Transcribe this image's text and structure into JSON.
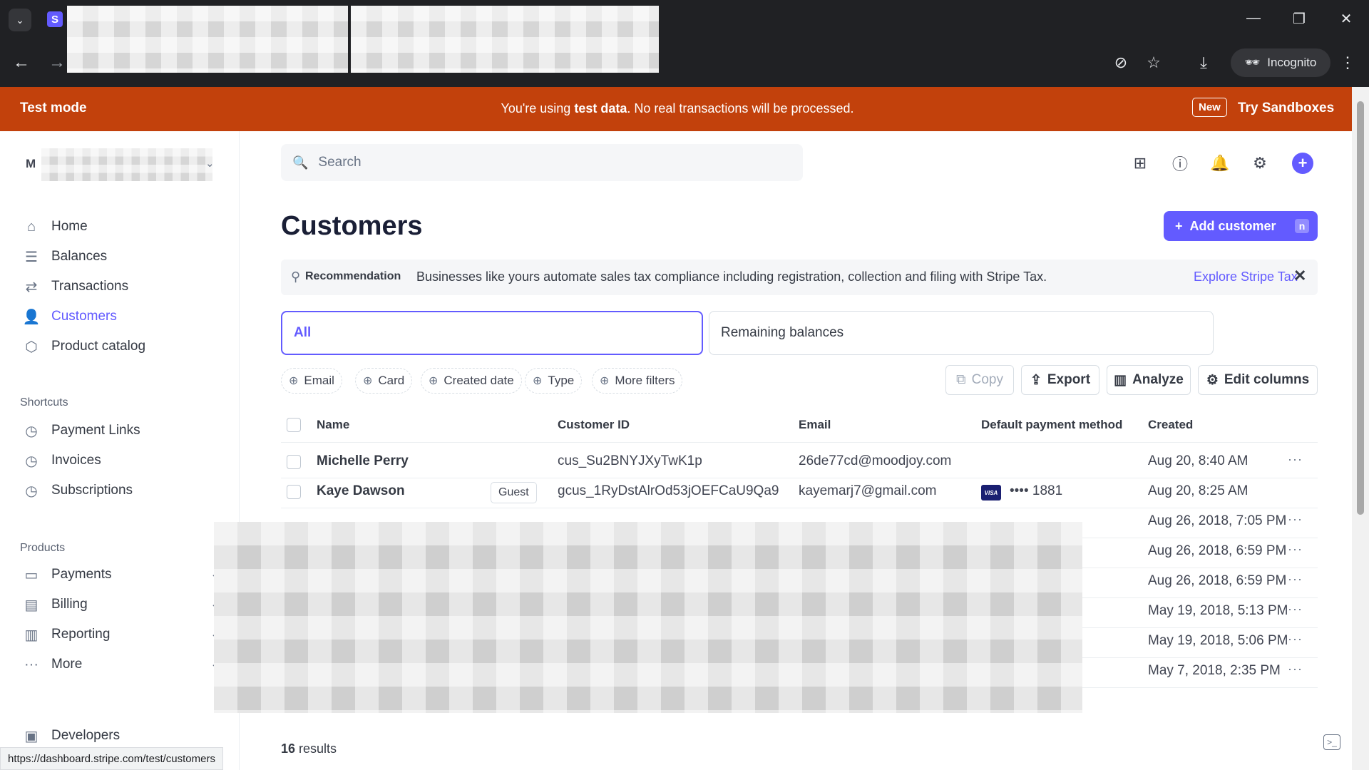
{
  "browser": {
    "profile_label": "Incognito",
    "status_url": "https://dashboard.stripe.com/test/customers"
  },
  "banner": {
    "mode": "Test mode",
    "message_prefix": "You're using ",
    "message_bold": "test data",
    "message_suffix": ". No real transactions will be processed.",
    "new_badge": "New",
    "sandbox_link": "Try Sandboxes"
  },
  "sidebar": {
    "account_initial": "M",
    "nav": [
      {
        "label": "Home",
        "icon": "home-icon"
      },
      {
        "label": "Balances",
        "icon": "balances-icon"
      },
      {
        "label": "Transactions",
        "icon": "transactions-icon"
      },
      {
        "label": "Customers",
        "icon": "customers-icon"
      },
      {
        "label": "Product catalog",
        "icon": "product-catalog-icon"
      }
    ],
    "shortcuts_heading": "Shortcuts",
    "shortcuts": [
      {
        "label": "Payment Links",
        "icon": "clock-icon"
      },
      {
        "label": "Invoices",
        "icon": "clock-icon"
      },
      {
        "label": "Subscriptions",
        "icon": "clock-icon"
      }
    ],
    "products_heading": "Products",
    "products": [
      {
        "label": "Payments",
        "icon": "payments-icon"
      },
      {
        "label": "Billing",
        "icon": "billing-icon"
      },
      {
        "label": "Reporting",
        "icon": "reporting-icon"
      },
      {
        "label": "More",
        "icon": "more-icon"
      }
    ],
    "developers": "Developers",
    "active_color": "#635bff"
  },
  "header": {
    "search_placeholder": "Search"
  },
  "page": {
    "title": "Customers",
    "add_button": "Add customer",
    "add_shortcut": "n",
    "recommendation": {
      "label": "Recommendation",
      "text": "Businesses like yours automate sales tax compliance including registration, collection and filing with Stripe Tax.",
      "link": "Explore Stripe Tax"
    },
    "segments": [
      "All",
      "Remaining balances"
    ],
    "filters": [
      "Email",
      "Card",
      "Created date",
      "Type",
      "More filters"
    ],
    "actions": {
      "copy": "Copy",
      "export": "Export",
      "analyze": "Analyze",
      "edit_columns": "Edit columns"
    },
    "columns": [
      "Name",
      "Customer ID",
      "Email",
      "Default payment method",
      "Created"
    ],
    "rows": [
      {
        "name": "Michelle Perry",
        "id": "cus_Su2BNYJXyTwK1p",
        "email": "26de77cd@moodjoy.com",
        "last4": "",
        "created": "Aug 20, 8:40 AM"
      },
      {
        "name": "Kaye Dawson",
        "badge": "Guest",
        "id": "gcus_1RyDstAlrOd53jOEFCaU9Qa9",
        "email": "kayemarj7@gmail.com",
        "last4": "•••• 1881",
        "created": "Aug 20, 8:25 AM"
      }
    ],
    "partial_created": [
      "Aug 26, 2018, 7:05 PM",
      "Aug 26, 2018, 6:59 PM",
      "Aug 26, 2018, 6:59 PM",
      "May 19, 2018, 5:13 PM",
      "May 19, 2018, 5:06 PM",
      "May 7, 2018, 2:35 PM"
    ],
    "results_count": "16",
    "results_label": " results"
  }
}
